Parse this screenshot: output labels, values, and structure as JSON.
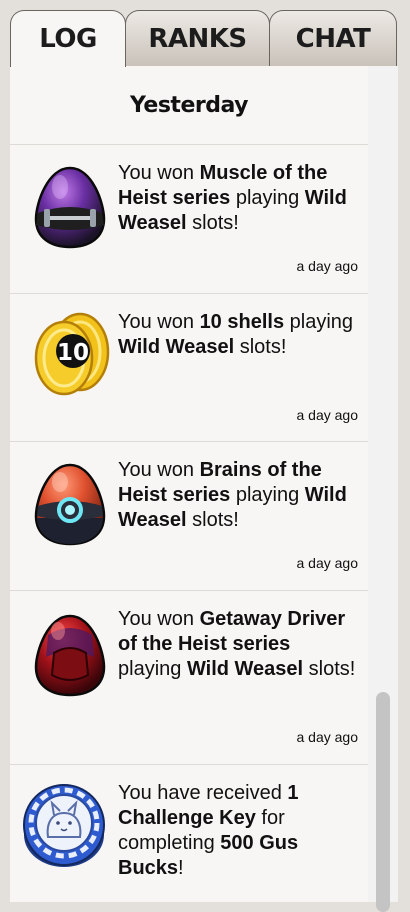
{
  "tabs": {
    "log": "LOG",
    "ranks": "RANKS",
    "chat": "CHAT"
  },
  "log": {
    "day_header": "Yesterday",
    "entries": [
      {
        "prefix": "You won ",
        "bold1": "Muscle of the Heist series",
        "mid": " playing ",
        "bold2": "Wild Weasel",
        "suffix": " slots!",
        "time": "a day ago",
        "icon": "muscle-egg-icon"
      },
      {
        "prefix": "You won ",
        "bold1": "10 shells",
        "mid": " playing ",
        "bold2": "Wild Weasel",
        "suffix": " slots!",
        "time": "a day ago",
        "icon": "shells-icon",
        "shell_count": "10"
      },
      {
        "prefix": "You won ",
        "bold1": "Brains of the Heist series",
        "mid": " playing ",
        "bold2": "Wild Weasel",
        "suffix": " slots!",
        "time": "a day ago",
        "icon": "brains-egg-icon"
      },
      {
        "prefix": "You won ",
        "bold1": "Getaway Driver of the Heist series",
        "mid": " playing ",
        "bold2": "Wild Weasel",
        "suffix": " slots!",
        "time": "a day ago",
        "icon": "driver-egg-icon"
      },
      {
        "prefix": "You have received ",
        "bold1": "1 Challenge Key",
        "mid": " for completing ",
        "bold2": "500 Gus Bucks",
        "suffix": "!",
        "time": "",
        "icon": "challenge-key-icon"
      }
    ]
  },
  "colors": {
    "accent": "#e0631d",
    "panel": "#f7f6f4",
    "background": "#e3e0dc"
  }
}
